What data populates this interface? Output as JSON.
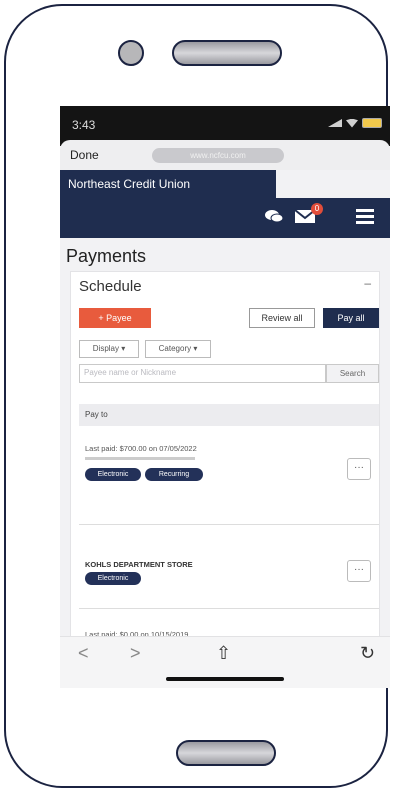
{
  "status": {
    "time": "3:43"
  },
  "browser": {
    "done_label": "Done",
    "url": "www.ncfcu.com"
  },
  "bank": {
    "name": "Northeast Credit Union"
  },
  "nav": {
    "chat_icon": "chat-bubbles-icon",
    "mail_icon": "mail-icon",
    "mail_badge": "0",
    "menu_icon": "hamburger-menu-icon"
  },
  "page": {
    "title": "Payments"
  },
  "schedule": {
    "title": "Schedule",
    "add_payee": "+ Payee",
    "review_all": "Review all",
    "pay_all": "Pay all",
    "display_dropdown": "Display ▾",
    "category_dropdown": "Category ▾",
    "search_placeholder": "Payee name or Nickname",
    "search_button": "Search",
    "pay_to_header": "Pay to"
  },
  "payees": [
    {
      "last_paid": "Last paid: $700.00 on 07/05/2022",
      "tags": [
        "Electronic",
        "Recurring"
      ],
      "more": "···"
    },
    {
      "name": "KOHLS DEPARTMENT STORE",
      "tags": [
        "Electronic"
      ],
      "more": "···"
    },
    {
      "last_paid": "Last paid: $0.00 on 10/15/2019",
      "more": "···"
    }
  ],
  "bottom_nav": {
    "back": "<",
    "forward": ">",
    "share": "⇧",
    "reload": "↻"
  },
  "colors": {
    "navy": "#1f2d4f",
    "accent": "#e85b3d",
    "badge": "#e14d3a"
  }
}
